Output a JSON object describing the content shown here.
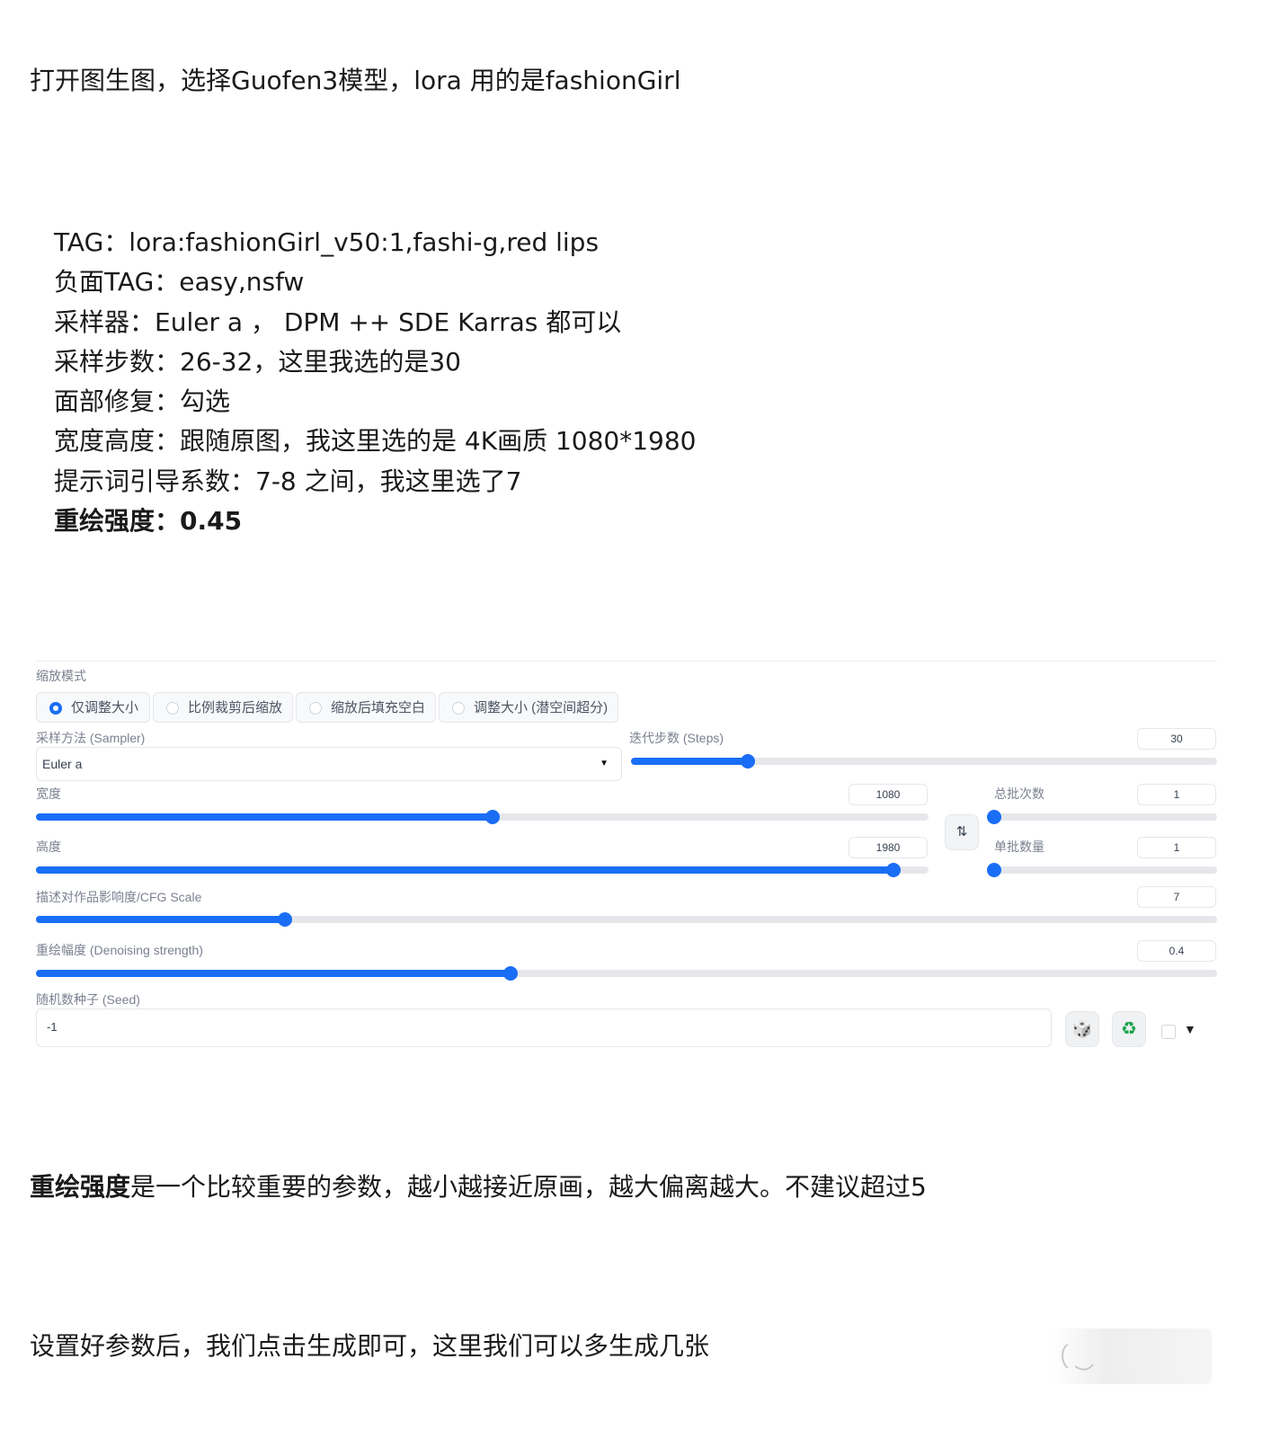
{
  "intro": "打开图生图，选择Guofen3模型，lora 用的是fashionGirl",
  "tags": [
    "TAG：lora:fashionGirl_v50:1,fashi-g,red lips",
    "负面TAG：easy,nsfw",
    "采样器：Euler a ， DPM ++ SDE Karras 都可以",
    "采样步数：26-32，这里我选的是30",
    "面部修复：勾选",
    "宽度高度：跟随原图，我这里选的是 4K画质 1080*1980",
    "提示词引导系数：7-8 之间，我这里选了7",
    "重绘强度：0.45"
  ],
  "panel": {
    "resize_mode_label": "缩放模式",
    "resize_options": [
      "仅调整大小",
      "比例裁剪后缩放",
      "缩放后填充空白",
      "调整大小 (潜空间超分)"
    ],
    "resize_selected_index": 0,
    "sampler_label": "采样方法 (Sampler)",
    "sampler_value": "Euler a",
    "steps_label": "迭代步数 (Steps)",
    "steps_value": "30",
    "steps_fraction": 0.2,
    "width_label": "宽度",
    "width_value": "1080",
    "width_fraction": 0.512,
    "height_label": "高度",
    "height_value": "1980",
    "height_fraction": 0.961,
    "swap_icon": "swap-vertical-icon",
    "swap_glyph": "⇅",
    "batch_count_label": "总批次数",
    "batch_count_value": "1",
    "batch_count_fraction": 0.0,
    "batch_size_label": "单批数量",
    "batch_size_value": "1",
    "batch_size_fraction": 0.0,
    "cfg_label": "描述对作品影响度/CFG Scale",
    "cfg_value": "7",
    "cfg_fraction": 0.211,
    "denoise_label": "重绘幅度 (Denoising strength)",
    "denoise_value": "0.4",
    "denoise_fraction": 0.402,
    "seed_label": "随机数种子 (Seed)",
    "seed_value": "-1",
    "dice_icon": "dice-icon",
    "recycle_icon": "recycle-icon",
    "dice_glyph": "🎲",
    "recycle_glyph": "♻",
    "dropdown_glyph": "▼",
    "accent_color": "#1a6ef5"
  },
  "note_bold": "重绘强度",
  "note_rest": "是一个比较重要的参数，越小越接近原画，越大偏离越大。不建议超过5",
  "final": "设置好参数后，我们点击生成即可，这里我们可以多生成几张"
}
